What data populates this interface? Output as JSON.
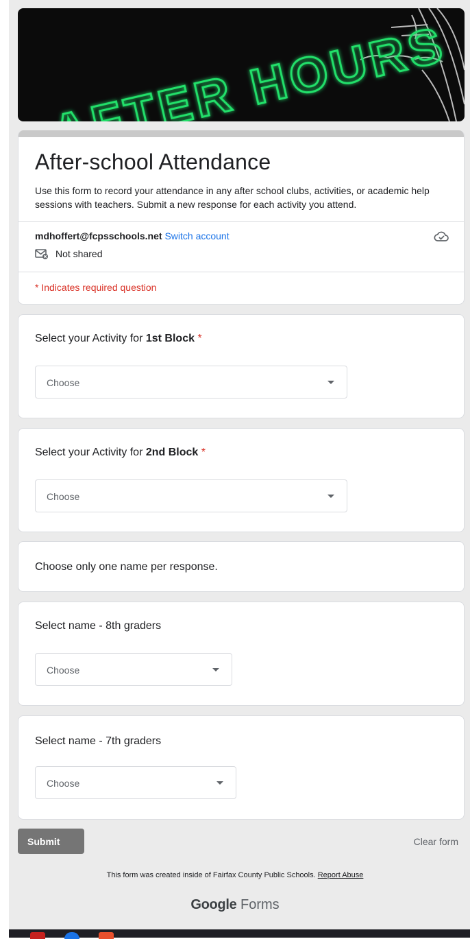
{
  "banner": {
    "text": "AFTER HOURS"
  },
  "form": {
    "title": "After-school Attendance",
    "description": "Use this form to record your attendance in any after school clubs, activities, or academic help sessions with teachers.  Submit a new response for each activity you attend.",
    "account_email": "mdhoffert@fcpsschools.net",
    "switch_account": "Switch account",
    "not_shared": "Not shared",
    "required_note": "* Indicates required question"
  },
  "questions": [
    {
      "label_prefix": "Select your Activity for ",
      "label_bold": "1st Block",
      "required": "*",
      "select_value": "Choose"
    },
    {
      "label_prefix": "Select your Activity for ",
      "label_bold": "2nd Block",
      "required": "*",
      "select_value": "Choose"
    },
    {
      "label": "Choose only one name per response."
    },
    {
      "label": "Select name - 8th graders",
      "select_value": "Choose"
    },
    {
      "label": "Select name - 7th graders",
      "select_value": "Choose"
    }
  ],
  "actions": {
    "submit": "Submit",
    "clear": "Clear form"
  },
  "footer": {
    "note": "This form was created inside of Fairfax County Public Schools. ",
    "report_abuse": "Report Abuse",
    "logo_google": "Google",
    "logo_forms": " Forms"
  },
  "colors": {
    "accent": "#1a73e8",
    "required": "#d93025",
    "banner_text": "#22e06b",
    "submit": "#757575"
  },
  "icons": [
    "cloud-check-icon",
    "mail-not-shared-icon",
    "dropdown-arrow-icon"
  ]
}
